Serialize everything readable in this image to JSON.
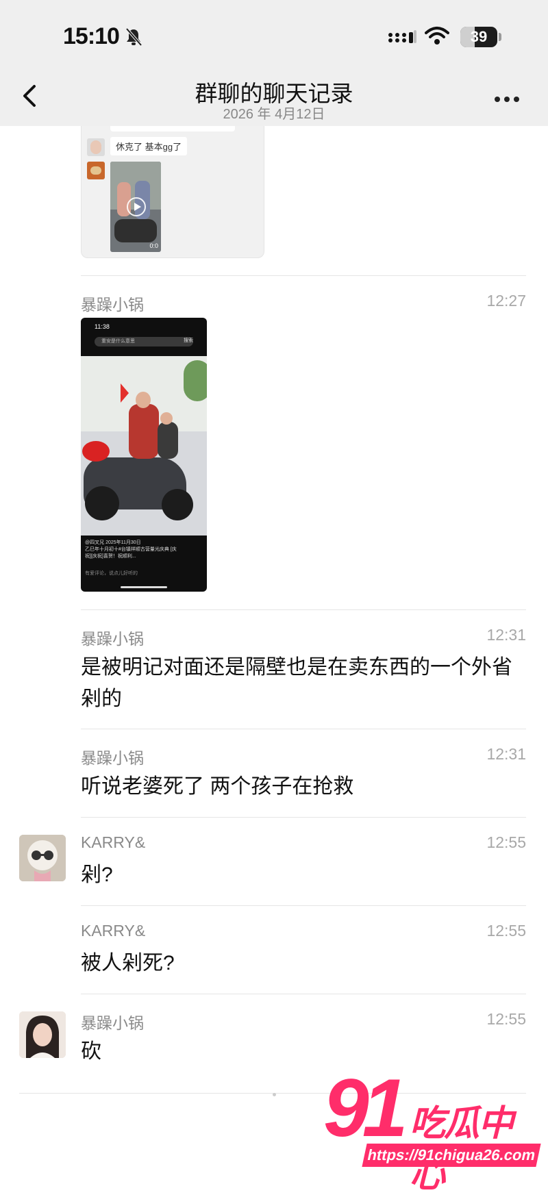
{
  "status_bar": {
    "time": "15:10",
    "battery": "39",
    "battery_level": 0.39
  },
  "header": {
    "title": "群聊的聊天记录",
    "date": "2026 年 4月12日"
  },
  "forwarded_card": {
    "message_text": "休克了 基本gg了",
    "video_duration": "0:0"
  },
  "messages": [
    {
      "sender": "暴躁小锅",
      "time": "12:27",
      "type": "image"
    },
    {
      "sender": "暴躁小锅",
      "time": "12:31",
      "text": "是被明记对面还是隔壁也是在卖东西的一个外省剁的"
    },
    {
      "sender": "暴躁小锅",
      "time": "12:31",
      "text": "听说老婆死了 两个孩子在抢救"
    },
    {
      "sender": "KARRY&",
      "time": "12:55",
      "text": "剁?"
    },
    {
      "sender": "KARRY&",
      "time": "12:55",
      "text": "被人剁死?"
    },
    {
      "sender": "暴躁小锅",
      "time": "12:55",
      "text": "砍"
    }
  ],
  "screenshot_image": {
    "status_time": "11:38",
    "search_placeholder": "重安是什么意思",
    "search_button": "搜索",
    "author": "@四叉兄",
    "post_date": "2025年11月30日",
    "caption": "乙巳年十月初十#台镇祥顺古营量光庆典 [庆祝][庆祝]喜贺！祝顺利...",
    "comment_placeholder": "有爱评论，说点儿好听的"
  },
  "watermark": {
    "number": "91",
    "name": "吃瓜中心",
    "url": "https://91chigua26.com"
  }
}
